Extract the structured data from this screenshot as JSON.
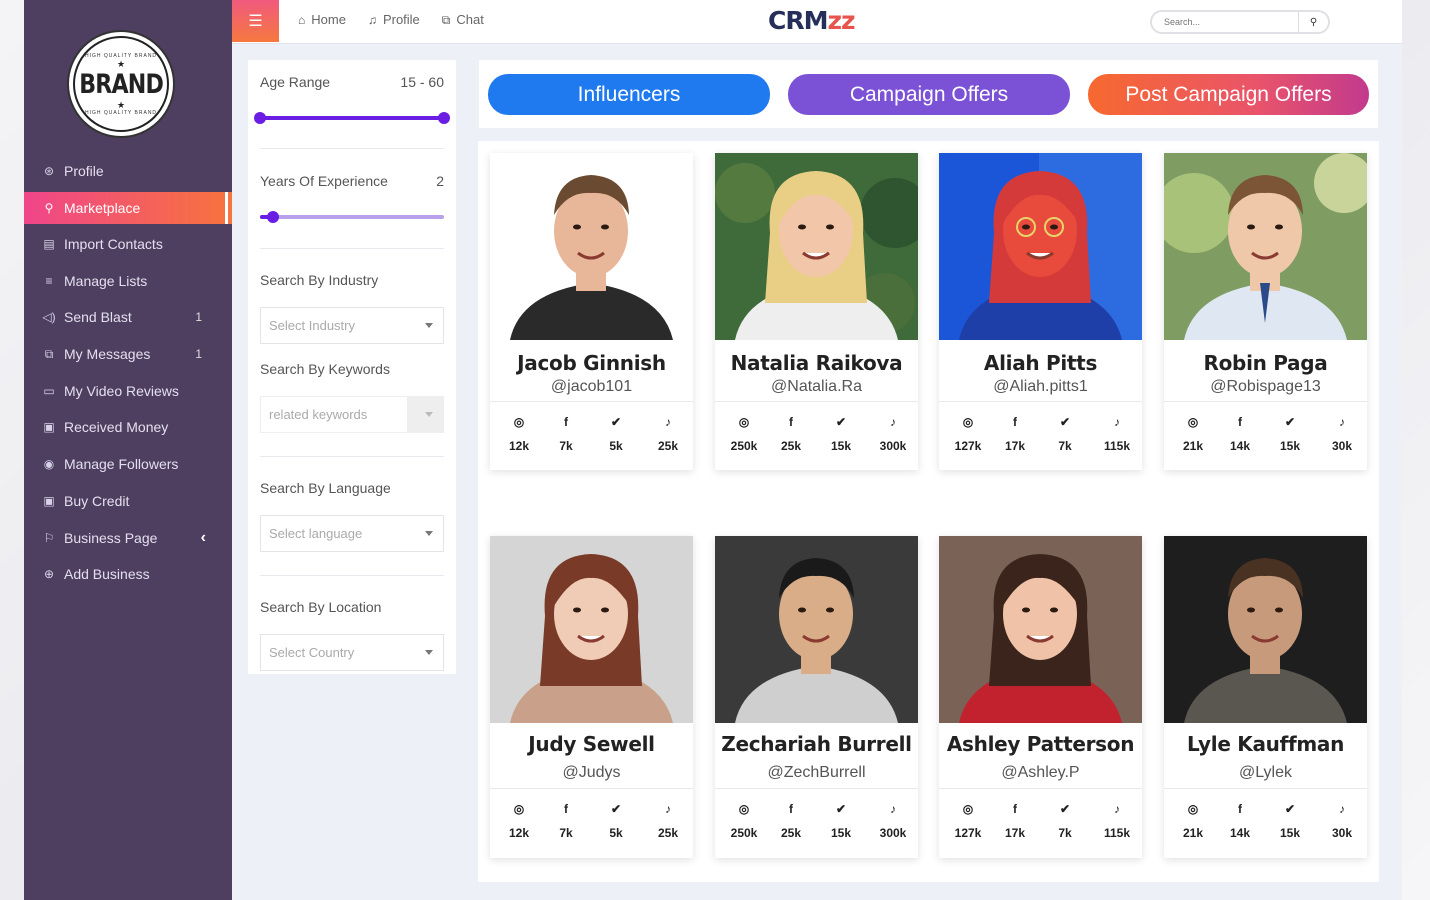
{
  "brand": {
    "logo_text": "BRAND",
    "logo_ring": "HIGH QUALITY BRAND",
    "title_a": "CRM",
    "title_b": "zz"
  },
  "sidebar": {
    "items": [
      {
        "label": "Profile",
        "icon": "user-circle-icon",
        "glyph": "⊛",
        "count": ""
      },
      {
        "label": "Marketplace",
        "icon": "search-icon",
        "glyph": "⚲",
        "count": "",
        "active": true
      },
      {
        "label": "Import Contacts",
        "icon": "contacts-icon",
        "glyph": "▤",
        "count": ""
      },
      {
        "label": "Manage Lists",
        "icon": "list-icon",
        "glyph": "≡",
        "count": ""
      },
      {
        "label": "Send Blast",
        "icon": "megaphone-icon",
        "glyph": "◁)",
        "count": "1"
      },
      {
        "label": "My Messages",
        "icon": "messages-icon",
        "glyph": "⧉",
        "count": "1"
      },
      {
        "label": "My Video Reviews",
        "icon": "video-icon",
        "glyph": "▭",
        "count": ""
      },
      {
        "label": "Received Money",
        "icon": "money-icon",
        "glyph": "▣",
        "count": ""
      },
      {
        "label": "Manage Followers",
        "icon": "eye-icon",
        "glyph": "◉",
        "count": ""
      },
      {
        "label": "Buy Credit",
        "icon": "credit-icon",
        "glyph": "▣",
        "count": ""
      },
      {
        "label": "Business Page",
        "icon": "flag-icon",
        "glyph": "⚐",
        "count": "",
        "chevron": "‹"
      },
      {
        "label": "Add Business",
        "icon": "plus-circle-icon",
        "glyph": "⊕",
        "count": ""
      }
    ]
  },
  "topbar": {
    "menu_glyph": "☰",
    "links": [
      {
        "label": "Home",
        "icon": "home-icon",
        "glyph": "⌂"
      },
      {
        "label": "Profile",
        "icon": "bell-icon",
        "glyph": "♫"
      },
      {
        "label": "Chat",
        "icon": "chat-icon",
        "glyph": "⧉"
      }
    ],
    "search_placeholder": "Search...",
    "search_glyph": "⚲"
  },
  "filters": {
    "age_label": "Age Range",
    "age_value": "15 - 60",
    "age_fraction": [
      0.0,
      1.0
    ],
    "exp_label": "Years Of Experience",
    "exp_value": "2",
    "exp_fraction": 0.07,
    "industry_label": "Search By Industry",
    "industry_placeholder": "Select Industry",
    "keywords_label": "Search By Keywords",
    "keywords_placeholder": "related keywords",
    "language_label": "Search By Language",
    "language_placeholder": "Select language",
    "location_label": "Search By Location",
    "location_placeholder": "Select Country"
  },
  "tabs": [
    {
      "label": "Influencers",
      "color": "#1f7af0"
    },
    {
      "label": "Campaign Offers",
      "color": "#7b52d6"
    },
    {
      "label": "Post Campaign Offers",
      "color": "#f26a3a"
    }
  ],
  "social_icons": [
    {
      "name": "instagram-icon",
      "glyph": "◎"
    },
    {
      "name": "facebook-icon",
      "glyph": "f"
    },
    {
      "name": "twitter-icon",
      "glyph": "✔"
    },
    {
      "name": "tiktok-icon",
      "glyph": "♪"
    }
  ],
  "influencers": [
    {
      "name": "Jacob Ginnish",
      "handle": "@jacob101",
      "stats": [
        "12k",
        "7k",
        "5k",
        "25k"
      ],
      "bg": "#ffffff",
      "skin": "#e8b79a",
      "hair": "#6a4a30",
      "shirt": "#2a2a2a"
    },
    {
      "name": "Natalia Raikova",
      "handle": "@Natalia.Ra",
      "stats": [
        "250k",
        "25k",
        "15k",
        "300k"
      ],
      "bg": "#3f6a3a",
      "skin": "#f2c6a8",
      "hair": "#e9cf85",
      "shirt": "#eeeeee"
    },
    {
      "name": "Aliah Pitts",
      "handle": "@Aliah.pitts1",
      "stats": [
        "127k",
        "17k",
        "7k",
        "115k"
      ],
      "bg": "#1b56d8",
      "skin": "#e84a3c",
      "hair": "#d53a3a",
      "shirt": "#1e3fa8"
    },
    {
      "name": "Robin Paga",
      "handle": "@Robispage13",
      "stats": [
        "21k",
        "14k",
        "15k",
        "30k"
      ],
      "bg": "#7f9c62",
      "skin": "#efc8aa",
      "hair": "#7b5535",
      "shirt": "#dfe7f2"
    },
    {
      "name": "Judy Sewell",
      "handle": "@Judys",
      "stats": [
        "12k",
        "7k",
        "5k",
        "25k"
      ],
      "bg": "#d5d5d5",
      "skin": "#f0cbb5",
      "hair": "#7a3a28",
      "shirt": "#c9a089"
    },
    {
      "name": "Zechariah Burrell",
      "handle": "@ZechBurrell",
      "stats": [
        "250k",
        "25k",
        "15k",
        "300k"
      ],
      "bg": "#3a3a3a",
      "skin": "#d9ad88",
      "hair": "#1a1a1a",
      "shirt": "#cfcfcf"
    },
    {
      "name": "Ashley Patterson",
      "handle": "@Ashley.P",
      "stats": [
        "127k",
        "17k",
        "7k",
        "115k"
      ],
      "bg": "#7b6256",
      "skin": "#f0c2a8",
      "hair": "#3a241c",
      "shirt": "#c2222d"
    },
    {
      "name": "Lyle Kauffman",
      "handle": "@Lylek",
      "stats": [
        "21k",
        "14k",
        "15k",
        "30k"
      ],
      "bg": "#1e1e1e",
      "skin": "#c79a7c",
      "hair": "#4a3222",
      "shirt": "#5a5650"
    }
  ]
}
